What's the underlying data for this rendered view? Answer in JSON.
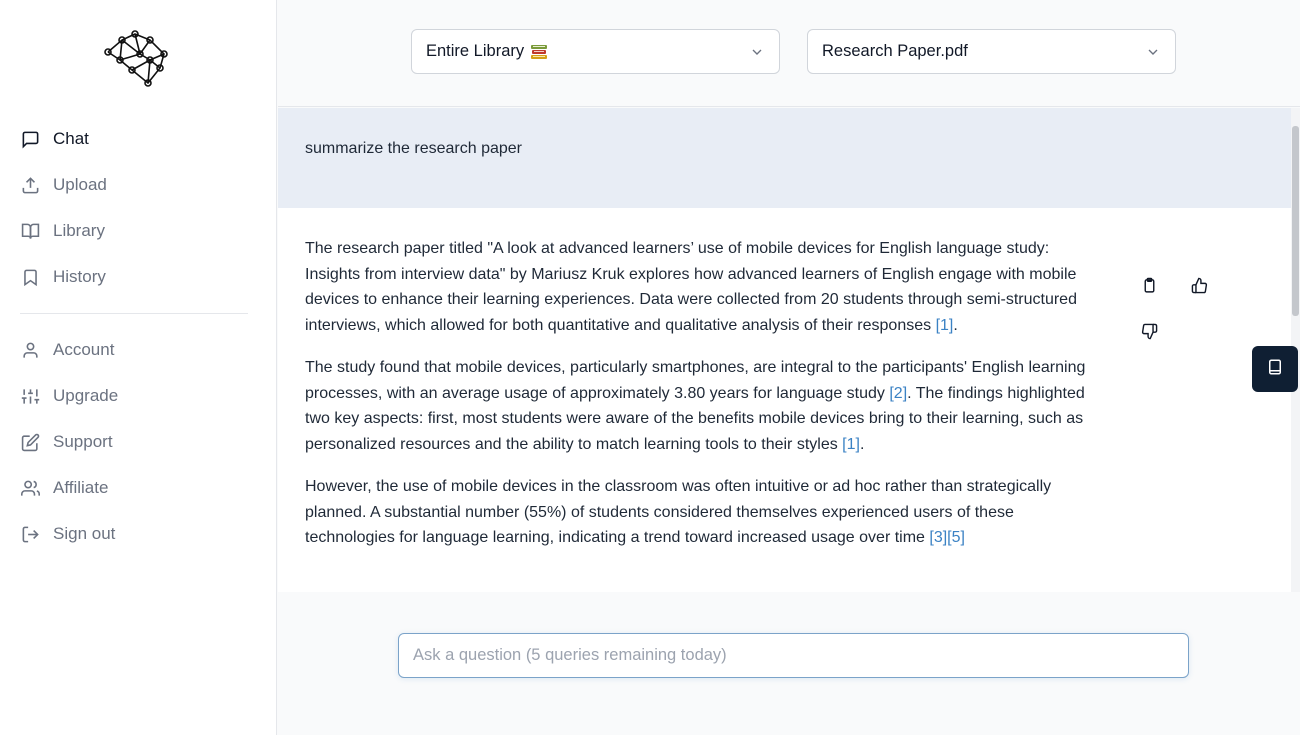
{
  "sidebar": {
    "logo_icon": "brain-network-icon",
    "items": [
      {
        "label": "Chat",
        "icon": "message-square-icon",
        "active": true
      },
      {
        "label": "Upload",
        "icon": "upload-icon"
      },
      {
        "label": "Library",
        "icon": "book-open-icon"
      },
      {
        "label": "History",
        "icon": "bookmark-icon"
      }
    ],
    "account_items": [
      {
        "label": "Account",
        "icon": "user-icon"
      },
      {
        "label": "Upgrade",
        "icon": "sliders-icon"
      },
      {
        "label": "Support",
        "icon": "edit-icon"
      },
      {
        "label": "Affiliate",
        "icon": "users-icon"
      },
      {
        "label": "Sign out",
        "icon": "sign-out-icon"
      }
    ]
  },
  "selectors": {
    "scope": {
      "value": "Entire Library",
      "emoji_icon": "books-icon"
    },
    "document": {
      "value": "Research Paper.pdf"
    }
  },
  "chat": {
    "user_message": "summarize the research paper",
    "answer": {
      "p1_text": "The research paper titled \"A look at advanced learners’ use of mobile devices for English language study: Insights from interview data\" by Mariusz Kruk explores how advanced learners of English engage with mobile devices to enhance their learning experiences. Data were collected from 20 students through semi-structured interviews, which allowed for both quantitative and qualitative analysis of their responses ",
      "p1_cite": "[1]",
      "p1_end": ".",
      "p2_text": "The study found that mobile devices, particularly smartphones, are integral to the participants' English learning processes, with an average usage of approximately 3.80 years for language study ",
      "p2_cite1": "[2]",
      "p2_mid": ". The findings highlighted two key aspects: first, most students were aware of the benefits mobile devices bring to their learning, such as personalized resources and the ability to match learning tools to their styles ",
      "p2_cite2": "[1]",
      "p2_end": ".",
      "p3_text": "However, the use of mobile devices in the classroom was often intuitive or ad hoc rather than strategically planned. A substantial number (55%) of students considered themselves experienced users of these technologies for language learning, indicating a trend toward increased usage over time ",
      "p3_cite": "[3][5]"
    },
    "actions": {
      "copy_icon": "clipboard-icon",
      "like_icon": "thumbs-up-icon",
      "dislike_icon": "thumbs-down-icon"
    }
  },
  "side_button_icon": "document-panel-icon",
  "input": {
    "placeholder": "Ask a question (5 queries remaining today)",
    "value": ""
  }
}
